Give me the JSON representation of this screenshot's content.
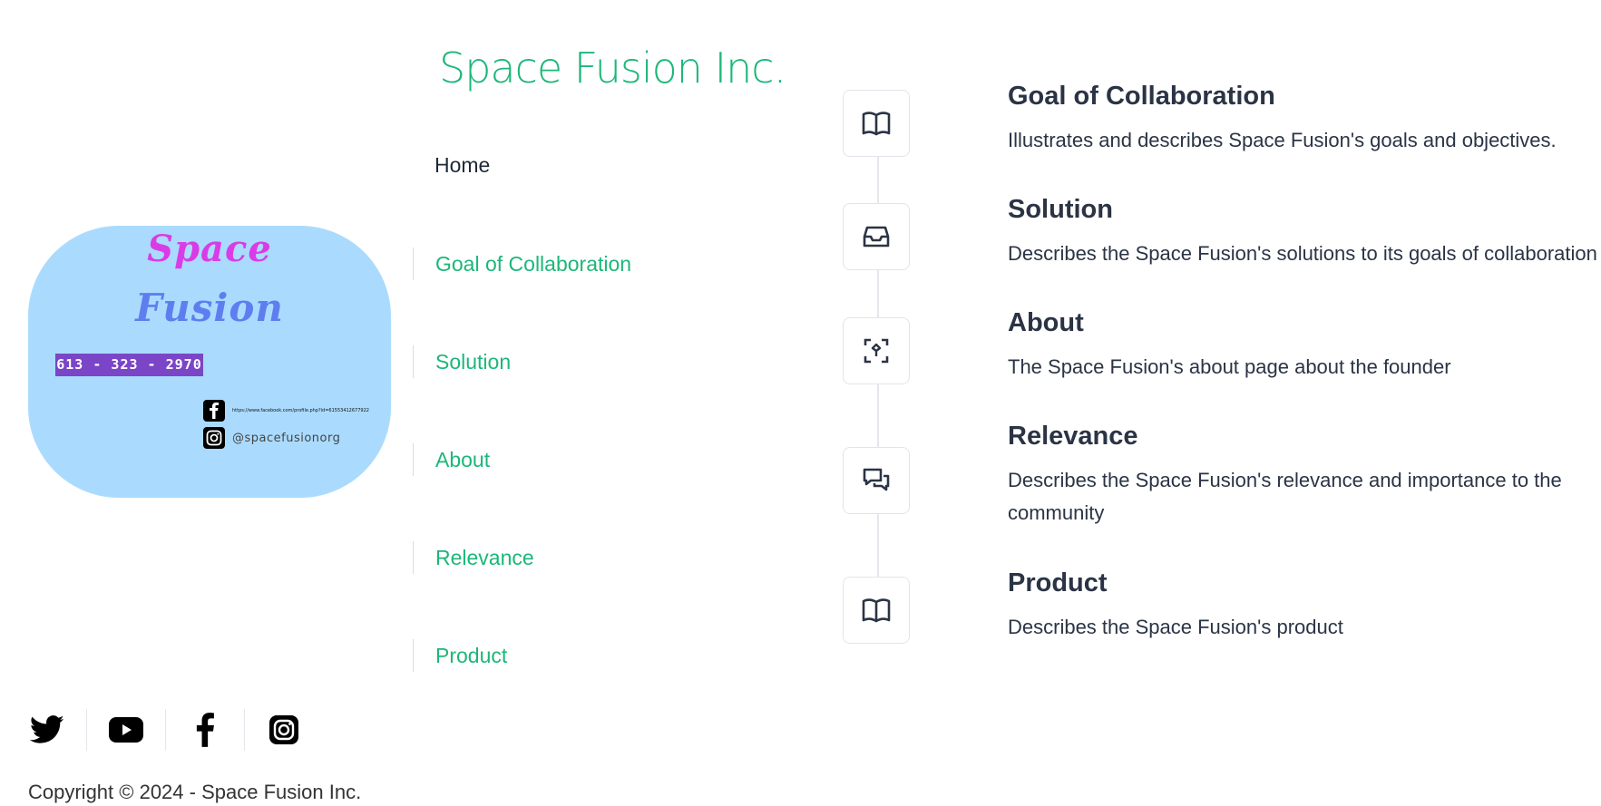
{
  "brand": "Space Fusion Inc.",
  "logo": {
    "word1": "Space",
    "word2": "Fusion",
    "phone": "613 - 323 - 2970",
    "facebook_url": "https://www.facebook.com/profile.php?id=61553412677922",
    "instagram_handle": "@spacefusionorg",
    "background_color": "#aadbfe"
  },
  "nav": {
    "home": "Home",
    "items": [
      "Goal of Collaboration",
      "Solution",
      "About",
      "Relevance",
      "Product"
    ]
  },
  "timeline": [
    {
      "icon": "book-icon",
      "title": "Goal of Collaboration",
      "description": "Illustrates and describes Space Fusion's goals and objectives."
    },
    {
      "icon": "inbox-icon",
      "title": "Solution",
      "description": "Describes the Space Fusion's solutions to its goals of collaboration"
    },
    {
      "icon": "focus-icon",
      "title": "About",
      "description": "The Space Fusion's about page about the founder"
    },
    {
      "icon": "messages-icon",
      "title": "Relevance",
      "description": "Describes the Space Fusion's relevance and importance to the community"
    },
    {
      "icon": "book-icon",
      "title": "Product",
      "description": "Describes the Space Fusion's product"
    }
  ],
  "footer": {
    "social_icons": [
      "twitter-icon",
      "youtube-icon",
      "facebook-icon",
      "instagram-icon"
    ],
    "copyright": "Copyright © 2024 - Space Fusion Inc."
  },
  "colors": {
    "accent": "#1cb77a",
    "text": "#2b3445",
    "phone_badge": "#7b45c8"
  }
}
